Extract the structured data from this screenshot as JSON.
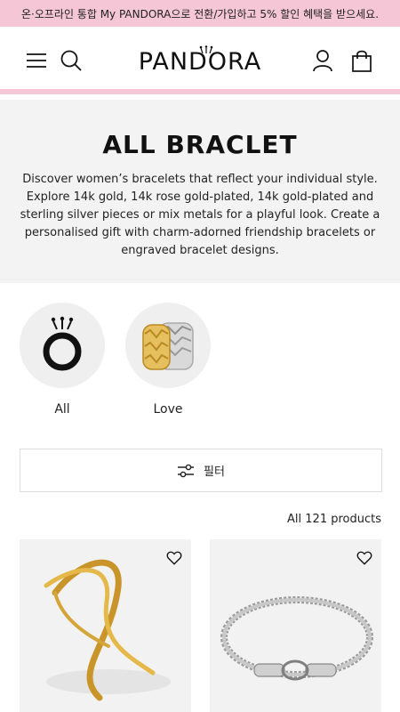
{
  "promo": {
    "text": "온·오프라인 통합 My PANDORA으로 전환/가입하고 5% 할인 혜택을 받으세요."
  },
  "header": {
    "logo": "PANDORA",
    "icons": {
      "menu": "hamburger-menu-icon",
      "search": "search-icon",
      "account": "user-icon",
      "cart": "shopping-bag-icon"
    }
  },
  "colors": {
    "promo_bg": "#f5c6d6",
    "hero_bg": "#f3f3f3",
    "accent_gold": "#d8a93b",
    "text": "#111111"
  },
  "hero": {
    "title": "ALL BRACLET",
    "description": "Discover women’s bracelets that reflect your individual style. Explore 14k gold, 14k rose gold-plated, 14k gold-plated and sterling silver pieces or mix metals for a playful look. Create a personalised gift with charm-adorned friendship bracelets or engraved bracelet designs."
  },
  "categories": [
    {
      "label": "All",
      "icon": "pandora-crown-o-logo"
    },
    {
      "label": "Love",
      "icon": "heart-rings-image"
    }
  ],
  "filter": {
    "label": "필터",
    "icon": "filter-sliders-icon"
  },
  "results": {
    "count_text": "All 121 products"
  },
  "products": [
    {
      "image": "gold-cuff-bracelet",
      "wishlist_icon": "heart-outline-icon"
    },
    {
      "image": "silver-chain-bracelet",
      "wishlist_icon": "heart-outline-icon"
    }
  ]
}
